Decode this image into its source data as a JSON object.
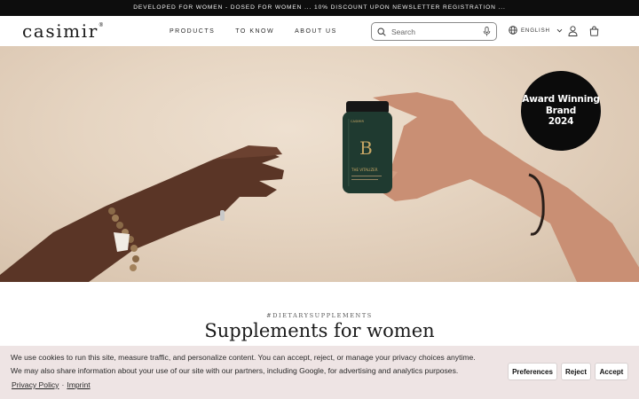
{
  "announcement": {
    "text": "DEVELOPED FOR WOMEN - DOSED FOR WOMEN ... 10% DISCOUNT UPON NEWSLETTER REGISTRATION ..."
  },
  "header": {
    "logo": "casimir",
    "logo_mark": "®",
    "nav": [
      "PRODUCTS",
      "TO KNOW",
      "ABOUT US"
    ],
    "search_placeholder": "Search",
    "language": "ENGLISH"
  },
  "hero": {
    "award": {
      "line1": "Award Winning",
      "line2": "Brand",
      "line3": "2024"
    },
    "bottle": {
      "letter": "B",
      "brand": "CASIMIR",
      "name": "THE VITALIZER"
    }
  },
  "section": {
    "hashtag": "#DIETARYSUPPLEMENTS",
    "headline": "Supplements for women"
  },
  "cookie": {
    "line1": "We use cookies to run this site, measure traffic, and personalize content. You can accept, reject, or manage your privacy choices anytime.",
    "line2": "We may also share information about your use of our site with our partners, including Google, for advertising and analytics purposes.",
    "privacy_link": "Privacy Policy",
    "separator": "·",
    "imprint_link": "Imprint",
    "preferences": "Preferences",
    "reject": "Reject",
    "accept": "Accept"
  },
  "colors": {
    "announcement_bg": "#0d0d0d",
    "cookie_bg": "#eee4e4",
    "bottle": "#1f3a30",
    "award_bg": "#0b0b0b"
  }
}
